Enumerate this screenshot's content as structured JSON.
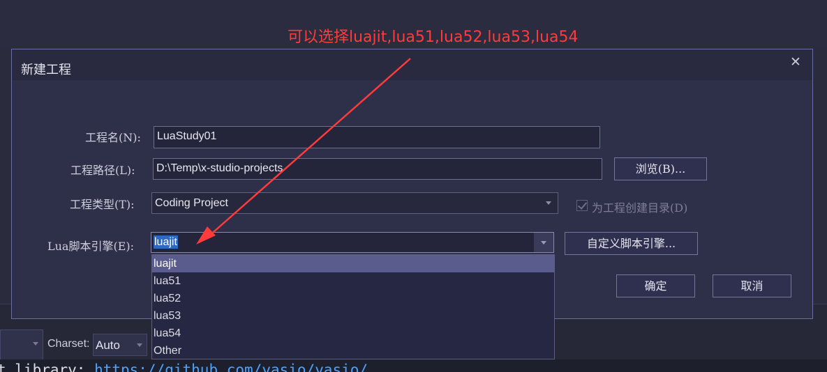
{
  "annotation": {
    "text": "可以选择luajit,lua51,lua52,lua53,lua54",
    "color": "#ff3b3b"
  },
  "background": {
    "charset_label": "Charset:",
    "charset_value": "Auto",
    "code_prefix": "t library: ",
    "code_link": "https://github.com/yasio/yasio/"
  },
  "dialog": {
    "title": "新建工程",
    "close_icon": "close-icon",
    "fields": {
      "name_label": "工程名(N):",
      "name_value": "LuaStudy01",
      "path_label": "工程路径(L):",
      "path_value": "D:\\Temp\\x-studio-projects",
      "browse_button": "浏览(B)...",
      "type_label": "工程类型(T):",
      "type_value": "Coding Project",
      "create_dir_label": "为工程创建目录(D)",
      "create_dir_checked": true,
      "engine_label": "Lua脚本引擎(E):",
      "engine_value": "luajit",
      "custom_engine_button": "自定义脚本引擎..."
    },
    "engine_options": [
      "luajit",
      "lua51",
      "lua52",
      "lua53",
      "lua54",
      "Other"
    ],
    "engine_selected_index": 0,
    "ok_button": "确定",
    "cancel_button": "取消"
  },
  "colors": {
    "accent_highlight": "#2f68c0",
    "dropdown_selected": "#5b5c8e",
    "annotation": "#ff3b3b"
  }
}
